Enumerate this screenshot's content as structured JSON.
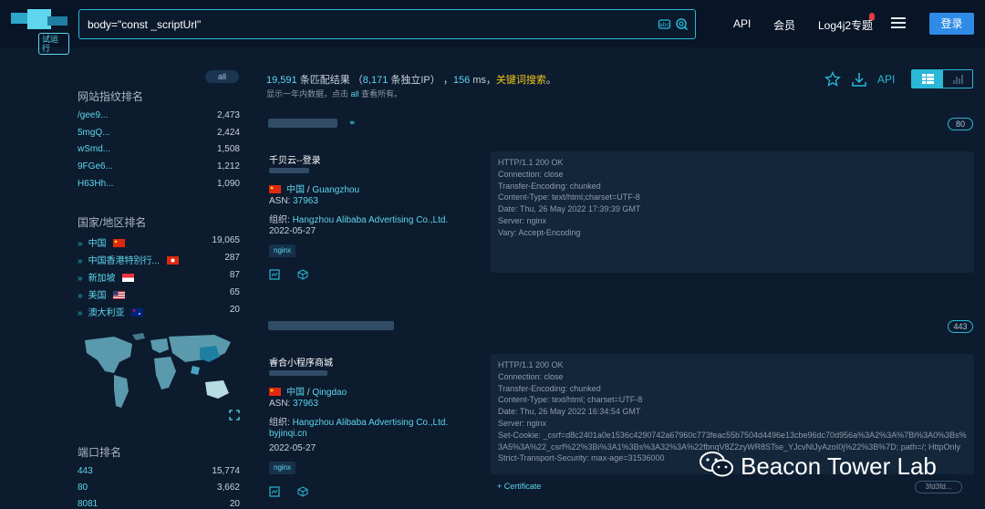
{
  "header": {
    "trial_label": "试运行",
    "search_query": "body=\"const _scriptUrl\"",
    "nav": [
      "API",
      "会员",
      "Log4j2专题"
    ],
    "login_label": "登录"
  },
  "sidebar": {
    "all_label": "all",
    "fingerprint_title": "网站指纹排名",
    "fingerprints": [
      {
        "key": "/gee9...",
        "count": "2,473"
      },
      {
        "key": "5mgQ...",
        "count": "2,424"
      },
      {
        "key": "wSmd...",
        "count": "1,508"
      },
      {
        "key": "9FGe6...",
        "count": "1,212"
      },
      {
        "key": "H63Hh...",
        "count": "1,090"
      }
    ],
    "country_title": "国家/地区排名",
    "countries": [
      {
        "name": "中国",
        "count": "19,065"
      },
      {
        "name": "中国香港特别行...",
        "count": "287"
      },
      {
        "name": "新加坡",
        "count": "87"
      },
      {
        "name": "美国",
        "count": "65"
      },
      {
        "name": "澳大利亚",
        "count": "20"
      }
    ],
    "port_title": "端口排名",
    "ports": [
      {
        "port": "443",
        "count": "15,774"
      },
      {
        "port": "80",
        "count": "3,662"
      },
      {
        "port": "8081",
        "count": "20"
      }
    ]
  },
  "summary": {
    "results": "19,591",
    "results_suffix": " 条匹配结果 （",
    "ips": "8,171",
    "ips_suffix": " 条独立IP） ，",
    "ms": "156",
    "ms_suffix": " ms，",
    "keyword": "关键词搜索",
    "end": "。",
    "sub_prefix": "显示一年内数据，点击 ",
    "sub_all": "all",
    "sub_suffix": " 查看所有。",
    "api_label": "API"
  },
  "results": [
    {
      "port": "80",
      "title": "千贝云--登录",
      "country": "中国",
      "city": "Guangzhou",
      "asn_label": "ASN: ",
      "asn": "37963",
      "org_label": "组织: ",
      "org": "Hangzhou Alibaba Advertising Co.,Ltd.",
      "date": "2022-05-27",
      "tag": "nginx",
      "headers": "HTTP/1.1 200 OK\nConnection: close\nTransfer-Encoding: chunked\nContent-Type: text/html;charset=UTF-8\nDate: Thu, 26 May 2022 17:39:39 GMT\nServer: nginx\nVary: Accept-Encoding"
    },
    {
      "port": "443",
      "title": "睿合小程序商城",
      "country": "中国",
      "city": "Qingdao",
      "asn_label": "ASN: ",
      "asn": "37963",
      "org_label": "组织: ",
      "org": "Hangzhou Alibaba Advertising Co.,Ltd.",
      "domain": "byjinqi.cn",
      "date": "2022-05-27",
      "tag": "nginx",
      "headers": "HTTP/1.1 200 OK\nConnection: close\nTransfer-Encoding: chunked\nContent-Type: text/html; charset=UTF-8\nDate: Thu, 26 May 2022 16:34:54 GMT\nServer: nginx\nSet-Cookie: _csrf=d8c2401a0e1536c4290742a67960c773feac55b7504d4496e13cbe96dc70d956a%3A2%3A%7Bi%3A0%3Bs%3A5%3A%22_csrf%22%3Bi%3A1%3Bs%3A32%3A%22fbnqV8Z2zyWR8STse_YJcvNlJyAzoI0j%22%3B%7D; path=/; HttpOnly\nStrict-Transport-Security: max-age=31536000",
      "cert_label": "+ Certificate",
      "cert_hash": "3fd3fd..."
    }
  ],
  "watermark": "Beacon Tower Lab",
  "colors": {
    "accent": "#2bb8d6",
    "link": "#5fd6ee",
    "highlight": "#f5c518",
    "login": "#2f8be6"
  }
}
